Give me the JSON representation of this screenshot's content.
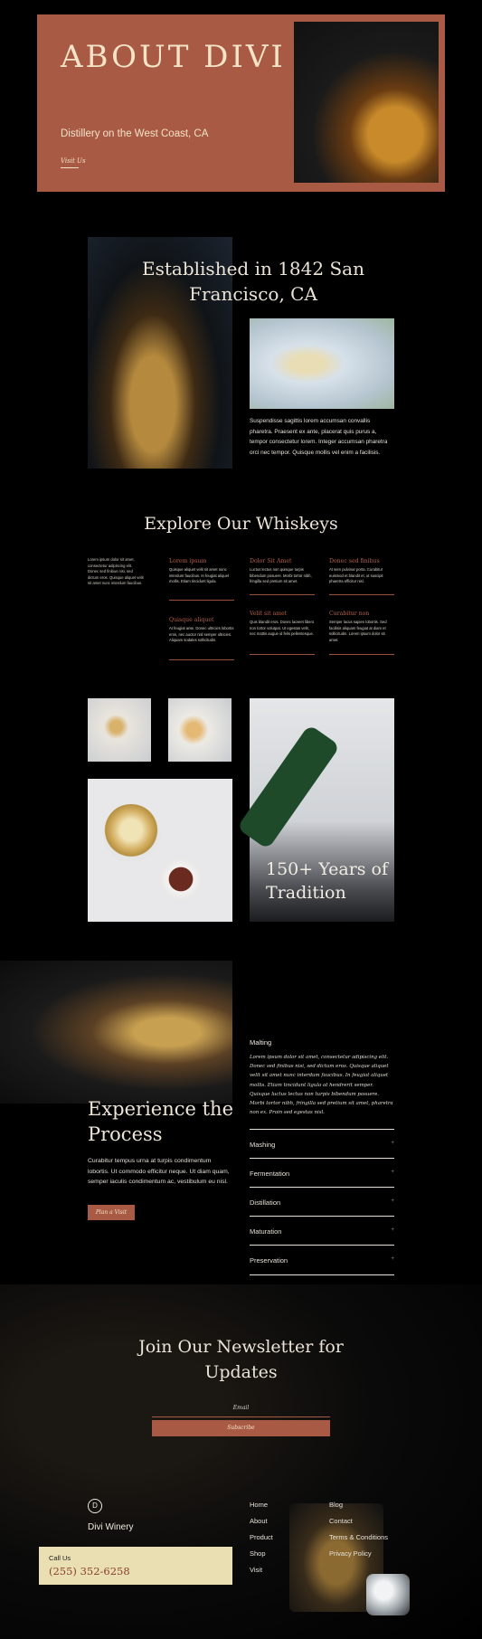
{
  "hero": {
    "title": "ABOUT DIVI",
    "subtitle": "Distillery on the West Coast, CA",
    "link": "Visit Us",
    "accent": "#a95a45"
  },
  "established": {
    "title": "Established in 1842 San Francisco, CA",
    "text": "Suspendisse sagittis lorem accumsan convallis pharetra. Praesent ex ante, placerat quis purus a, tempor consectetur lorem. Integer accumsan pharetra orci nec tempor. Quisque mollis vel enim a facilisis."
  },
  "explore": {
    "title": "Explore Our Whiskeys",
    "intro": "Lorem ipsum dolor sit amet, consectetur adipiscing elit. Donec sed finibus nisi, sed dictum eros. Quisque aliquet velit sit amet nunc interdum faucibus.",
    "items": [
      {
        "heading": "Lorem ipsum",
        "text": "Quisque aliquet velit sit amet nunc interdum faucibus. In feugiat aliquet mollis. Etiam tincidunt ligula."
      },
      {
        "heading": "Dolor Sit Amet",
        "text": "Luctus lectus non quisque turpis bibendum posuere. Morbi tortor nibh, fringilla sed pretium sit amet."
      },
      {
        "heading": "Donec sed finibus",
        "text": "At sem pulvinar porta. Curabitur euismod et blandit et, ut suscipit pharetra efficitur nisl."
      },
      {
        "heading": "Quisque aliquet",
        "text": "At feugiat ante. Donec ultricies lobortis eros, nec auctor nisl semper ultricies. Aliquam sodales sollicitudin."
      },
      {
        "heading": "Velit sit amet",
        "text": "Quis blandit eros. Donec laoreet libero non tortor volutpat. Ut egestas velit, nec mattis augue id felis pellentesque."
      },
      {
        "heading": "Curabitur non",
        "text": "Semper lacus sapien lobortis. Sed facilisis aliquam feugiat at diam et sollicitudin. Lorem ipsum dolor sit amet."
      }
    ]
  },
  "gallery": {
    "caption": "150+ Years of Tradition"
  },
  "process": {
    "title": "Experience the Process",
    "text": "Curabitur tempus urna at turpis condimentum lobortis. Ut commodo efficitur neque. Ut diam quam, semper iaculis condimentum ac, vestibulum eu nisl.",
    "button": "Plan a Visit",
    "malting_heading": "Malting",
    "malting_text": "Lorem ipsum dolor sit amet, consectetur adipiscing elit. Donec sed finibus nisi, sed dictum eros. Quisque aliquet velit sit amet nunc interdum faucibus. In feugiat aliquet mollis. Etiam tincidunt ligula at hendrerit semper. Quisque luctus lectus non turpis bibendum posuere. Morbi tortor nibh, fringilla sed pretium sit amet, pharetra non ex. Proin sed egestas nisl.",
    "steps": [
      "Mashing",
      "Fermentation",
      "Distillation",
      "Maturation",
      "Preservation"
    ],
    "step_icon": "plus-icon"
  },
  "newsletter": {
    "title": "Join Our Newsletter for Updates",
    "email_label": "Email",
    "button": "Subscribe"
  },
  "footer": {
    "logo_letter": "D",
    "brand": "Divi Winery",
    "col1": [
      "Home",
      "About",
      "Product",
      "Shop",
      "Visit"
    ],
    "col2": [
      "Blog",
      "Contact",
      "Terms & Conditions",
      "Privacy Policy"
    ],
    "call_label": "Call Us",
    "phone": "(255) 352-6258"
  }
}
